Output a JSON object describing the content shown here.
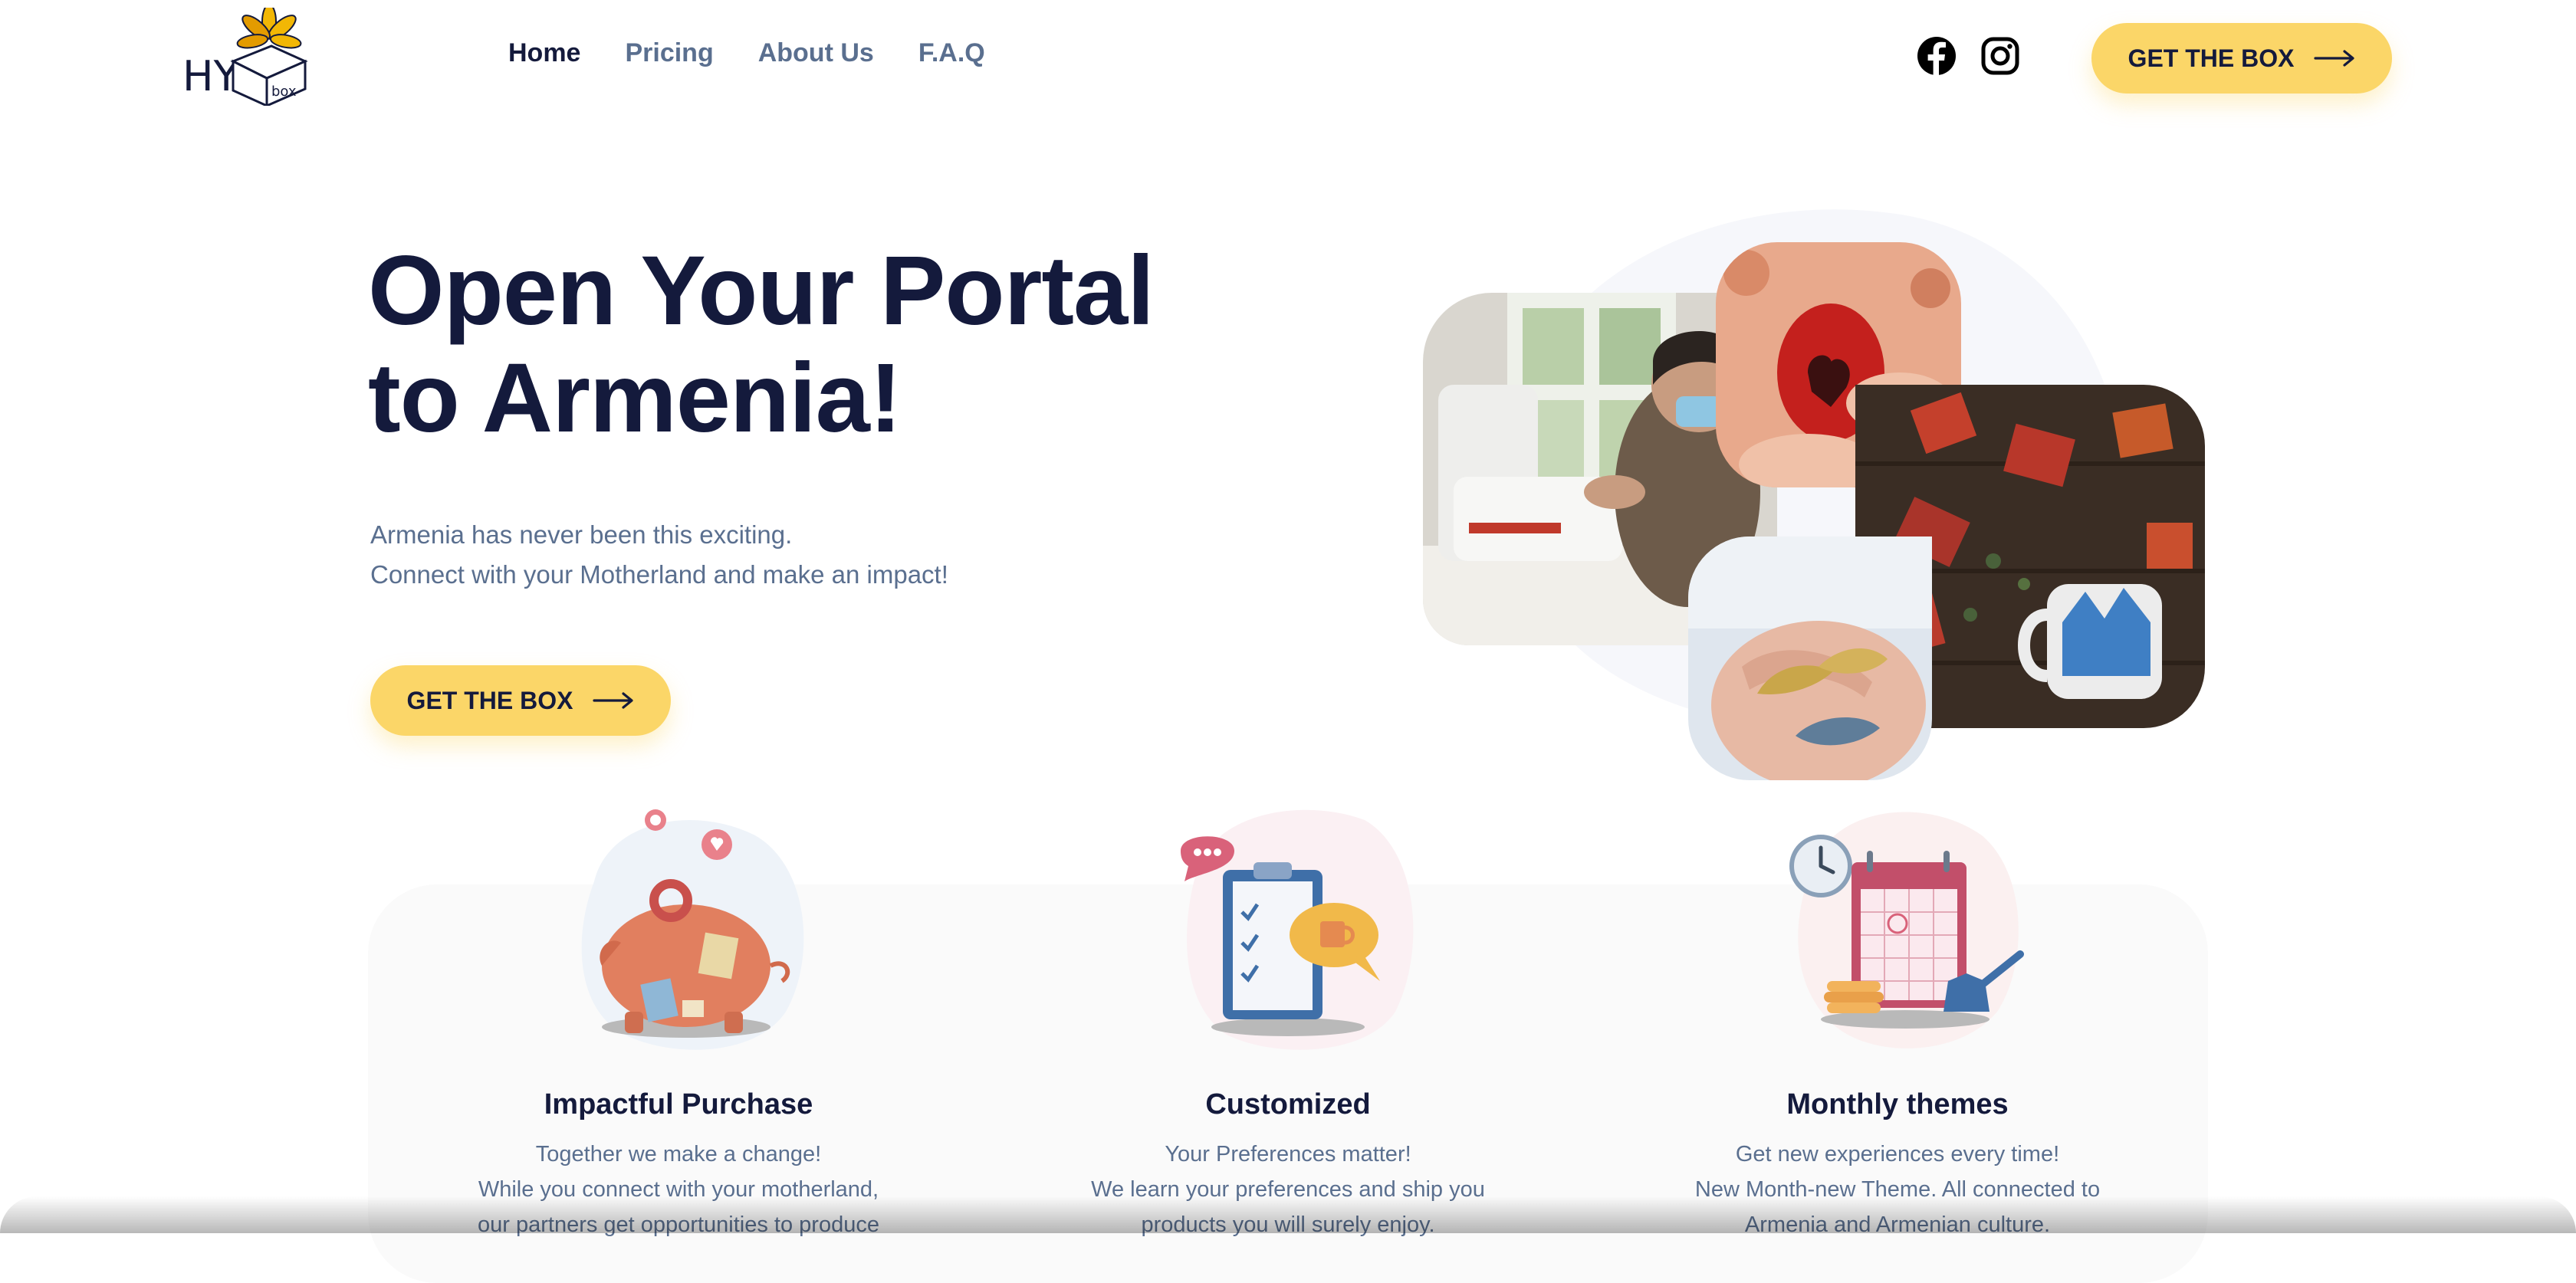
{
  "brand": {
    "logo_text": "HYE",
    "logo_box_text": "box"
  },
  "nav": [
    {
      "label": "Home",
      "active": true
    },
    {
      "label": "Pricing",
      "active": false
    },
    {
      "label": "About Us",
      "active": false
    },
    {
      "label": "F.A.Q",
      "active": false
    }
  ],
  "social": {
    "facebook_icon": "facebook-icon",
    "instagram_icon": "instagram-icon"
  },
  "header": {
    "cta_label": "GET THE BOX"
  },
  "hero": {
    "title_line1": "Open Your Portal",
    "title_line2": "to Armenia!",
    "subtitle_line1": "Armenia has never been this exciting.",
    "subtitle_line2": "Connect with your Motherland and make an impact!",
    "cta_label": "GET THE BOX"
  },
  "features": [
    {
      "title": "Impactful Purchase",
      "lines": [
        "Together we make a change!",
        "While you connect with your motherland,",
        "our partners get opportunities to produce"
      ],
      "icon": "piggy-bank-illustration"
    },
    {
      "title": "Customized",
      "lines": [
        "Your Preferences matter!",
        "We learn your preferences and ship you",
        "products you will surely enjoy."
      ],
      "icon": "checklist-illustration"
    },
    {
      "title": "Monthly themes",
      "lines": [
        "Get new experiences every time!",
        "New Month-new Theme. All connected to",
        "Armenia and Armenian culture."
      ],
      "icon": "calendar-illustration"
    }
  ],
  "colors": {
    "accent": "#fbd668",
    "heading": "#141a3c",
    "text": "#5a6f8f",
    "panel": "#fafafa"
  }
}
